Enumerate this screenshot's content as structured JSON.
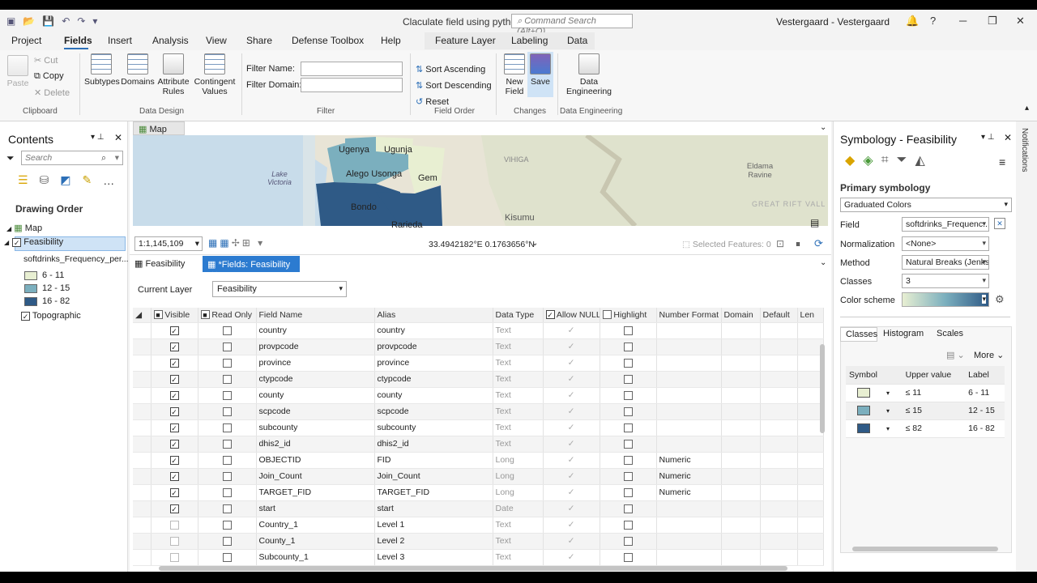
{
  "titlebar": {
    "doc_title": "Claculate field using python",
    "command_search": "Command Search (Alt+Q)",
    "user": "Vestergaard - Vestergaard"
  },
  "tabs": [
    "Project",
    "Fields",
    "Insert",
    "Analysis",
    "View",
    "Share",
    "Defense Toolbox",
    "Help",
    "Feature Layer",
    "Labeling",
    "Data"
  ],
  "ribbon": {
    "clipboard": {
      "paste": "Paste",
      "cut": "Cut",
      "copy": "Copy",
      "delete": "Delete",
      "label": "Clipboard"
    },
    "data_design": {
      "subtypes": "Subtypes",
      "domains": "Domains",
      "attribute_rules": "Attribute Rules",
      "contingent_values": "Contingent Values",
      "label": "Data Design"
    },
    "filter": {
      "name_label": "Filter Name:",
      "domain_label": "Filter Domain:",
      "label": "Filter"
    },
    "field_order": {
      "asc": "Sort Ascending",
      "desc": "Sort Descending",
      "reset": "Reset",
      "label": "Field Order"
    },
    "changes": {
      "new_field": "New Field",
      "save": "Save",
      "label": "Changes"
    },
    "data_engineering": {
      "button": "Data Engineering",
      "label": "Data Engineering"
    }
  },
  "contents": {
    "title": "Contents",
    "search_placeholder": "Search",
    "drawing_order": "Drawing Order",
    "map": "Map",
    "layer": "Feasibility",
    "field": "softdrinks_Frequency_per...",
    "legend": [
      {
        "label": "6 - 11",
        "color": "#e8efd2"
      },
      {
        "label": "12 - 15",
        "color": "#7bafbe"
      },
      {
        "label": "16 - 82",
        "color": "#2f5a86"
      }
    ],
    "topographic": "Topographic"
  },
  "map": {
    "tab": "Map",
    "labels": [
      "Ugenya",
      "Ugunja",
      "Alego Usonga",
      "Gem",
      "Lake Victoria",
      "Bondo",
      "Rarieda",
      "Kisumu",
      "VIHIGA",
      "Eldama Ravine",
      "GREAT RIFT VALLE"
    ],
    "scale": "1:1,145,109",
    "coords": "33.4942182°E 0.1763656°N",
    "selected": "Selected Features: 0"
  },
  "view_tabs": {
    "table": "Feasibility",
    "fields": "*Fields: Feasibility"
  },
  "fields_view": {
    "current_layer_label": "Current Layer",
    "current_layer": "Feasibility",
    "columns": [
      "Visible",
      "Read Only",
      "Field Name",
      "Alias",
      "Data Type",
      "Allow NULL",
      "Highlight",
      "Number Format",
      "Domain",
      "Default",
      "Len"
    ],
    "rows": [
      {
        "visible": true,
        "name": "country",
        "alias": "country",
        "type": "Text",
        "fmt": ""
      },
      {
        "visible": true,
        "name": "provpcode",
        "alias": "provpcode",
        "type": "Text",
        "fmt": ""
      },
      {
        "visible": true,
        "name": "province",
        "alias": "province",
        "type": "Text",
        "fmt": ""
      },
      {
        "visible": true,
        "name": "ctypcode",
        "alias": "ctypcode",
        "type": "Text",
        "fmt": ""
      },
      {
        "visible": true,
        "name": "county",
        "alias": "county",
        "type": "Text",
        "fmt": ""
      },
      {
        "visible": true,
        "name": "scpcode",
        "alias": "scpcode",
        "type": "Text",
        "fmt": ""
      },
      {
        "visible": true,
        "name": "subcounty",
        "alias": "subcounty",
        "type": "Text",
        "fmt": ""
      },
      {
        "visible": true,
        "name": "dhis2_id",
        "alias": "dhis2_id",
        "type": "Text",
        "fmt": ""
      },
      {
        "visible": true,
        "name": "OBJECTID",
        "alias": "FID",
        "type": "Long",
        "fmt": "Numeric"
      },
      {
        "visible": true,
        "name": "Join_Count",
        "alias": "Join_Count",
        "type": "Long",
        "fmt": "Numeric"
      },
      {
        "visible": true,
        "name": "TARGET_FID",
        "alias": "TARGET_FID",
        "type": "Long",
        "fmt": "Numeric"
      },
      {
        "visible": true,
        "name": "start",
        "alias": "start",
        "type": "Date",
        "fmt": ""
      },
      {
        "visible": false,
        "name": "Country_1",
        "alias": "Level 1",
        "type": "Text",
        "fmt": ""
      },
      {
        "visible": false,
        "name": "County_1",
        "alias": "Level 2",
        "type": "Text",
        "fmt": ""
      },
      {
        "visible": false,
        "name": "Subcounty_1",
        "alias": "Level 3",
        "type": "Text",
        "fmt": ""
      }
    ]
  },
  "symbology": {
    "title": "Symbology - Feasibility",
    "primary": "Primary symbology",
    "renderer": "Graduated Colors",
    "field_label": "Field",
    "field": "softdrinks_Frequenc...",
    "normalization_label": "Normalization",
    "normalization": "<None>",
    "method_label": "Method",
    "method": "Natural Breaks (Jenks)",
    "classes_label": "Classes",
    "classes": "3",
    "scheme_label": "Color scheme",
    "subtabs": [
      "Classes",
      "Histogram",
      "Scales"
    ],
    "more": "More",
    "class_headers": [
      "Symbol",
      "Upper value",
      "Label"
    ],
    "class_rows": [
      {
        "color": "#e8efd2",
        "upper": "11",
        "label": "6 - 11"
      },
      {
        "color": "#7bafbe",
        "upper": "15",
        "label": "12 - 15"
      },
      {
        "color": "#2f5a86",
        "upper": "82",
        "label": "16 - 82"
      }
    ]
  },
  "notifications": "Notifications"
}
